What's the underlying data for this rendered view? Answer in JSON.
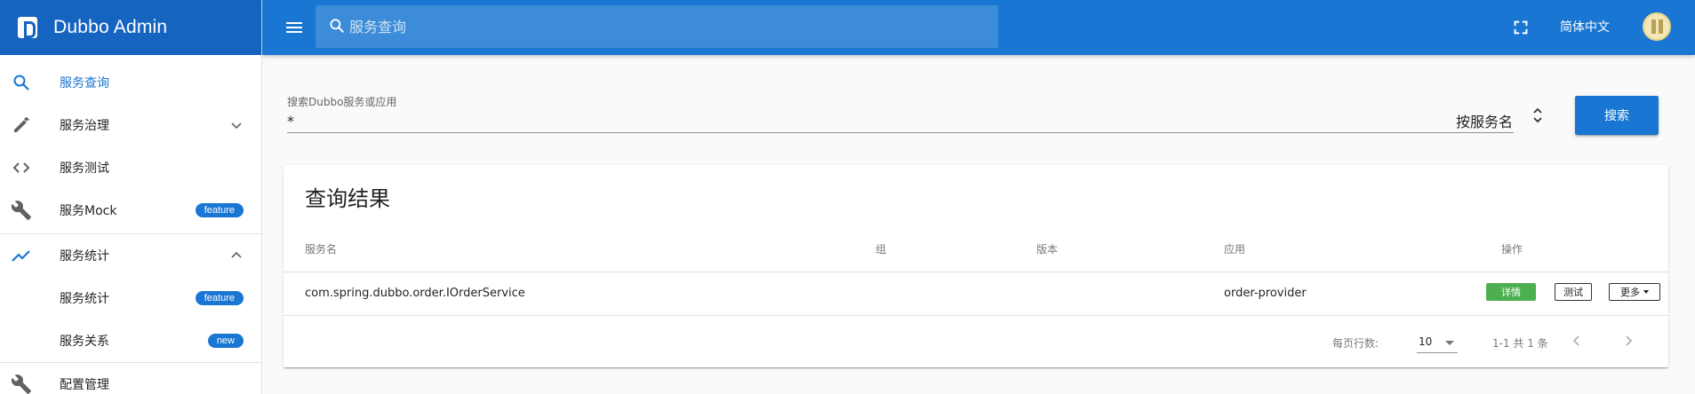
{
  "app": {
    "title": "Dubbo Admin"
  },
  "header": {
    "search_placeholder": "服务查询",
    "language": "简体中文"
  },
  "sidebar": {
    "items": [
      {
        "label": "服务查询",
        "icon": "search-icon",
        "active": true
      },
      {
        "label": "服务治理",
        "icon": "pencil-icon",
        "expandable": true,
        "expanded": false
      },
      {
        "label": "服务测试",
        "icon": "code-icon"
      },
      {
        "label": "服务Mock",
        "icon": "wrench-icon",
        "badge": "feature"
      },
      {
        "label": "服务统计",
        "icon": "trending-up-icon",
        "expandable": true,
        "expanded": true
      },
      {
        "label": "服务统计",
        "badge": "feature",
        "sub": true
      },
      {
        "label": "服务关系",
        "badge": "new",
        "sub": true
      },
      {
        "label": "配置管理",
        "icon": "wrench-icon"
      }
    ]
  },
  "search": {
    "label": "搜索Dubbo服务或应用",
    "value": "*",
    "mode": "按服务名",
    "button": "搜索"
  },
  "results": {
    "title": "查询结果",
    "columns": [
      "服务名",
      "组",
      "版本",
      "应用",
      "操作"
    ],
    "rows": [
      {
        "service": "com.spring.dubbo.order.IOrderService",
        "group": "",
        "version": "",
        "app": "order-provider"
      }
    ],
    "actions": {
      "detail": "详情",
      "test": "测试",
      "more": "更多"
    },
    "pagination": {
      "rows_per_page_label": "每页行数:",
      "rows_per_page": "10",
      "range": "1-1 共 1 条"
    }
  },
  "colors": {
    "primary": "#1976d2",
    "brand_bar": "#1565c0",
    "success": "#4caf50"
  }
}
